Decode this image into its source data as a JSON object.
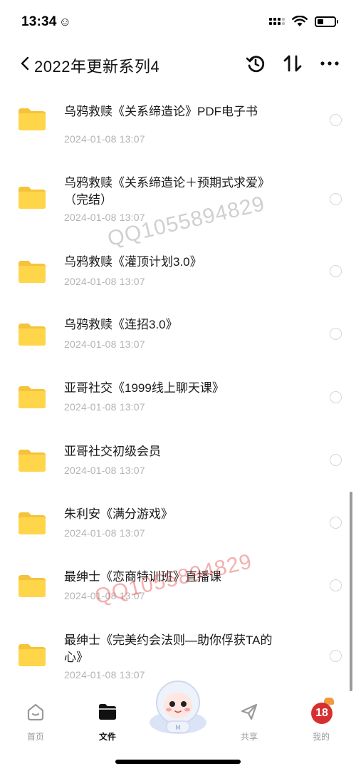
{
  "status": {
    "time": "13:34",
    "face_glyph": "☺"
  },
  "nav": {
    "title": "2022年更新系列4"
  },
  "files": [
    {
      "name": "乌鸦救赎《关系缔造论》PDF电子书",
      "date": "2024-01-08 13:07"
    },
    {
      "name": "乌鸦救赎《关系缔造论＋预期式求爱》（完结）",
      "date": "2024-01-08 13:07"
    },
    {
      "name": "乌鸦救赎《灌顶计划3.0》",
      "date": "2024-01-08 13:07"
    },
    {
      "name": "乌鸦救赎《连招3.0》",
      "date": "2024-01-08 13:07"
    },
    {
      "name": "亚哥社交《1999线上聊天课》",
      "date": "2024-01-08 13:07"
    },
    {
      "name": "亚哥社交初级会员",
      "date": "2024-01-08 13:07"
    },
    {
      "name": "朱利安《满分游戏》",
      "date": "2024-01-08 13:07"
    },
    {
      "name": "最绅士《恋商特训班》直播课",
      "date": "2024-01-08 13:07"
    },
    {
      "name": "最绅士《完美约会法则—助你俘获TA的心》",
      "date": "2024-01-08 13:07"
    }
  ],
  "watermarks": [
    "QQ1055894829",
    "QQ1055894829"
  ],
  "tabs": {
    "home": "首页",
    "files": "文件",
    "share": "共享",
    "mine": "我的"
  },
  "badge": "18",
  "colors": {
    "folder": "#FFD54A",
    "active": "#111111",
    "inactive": "#9A9A9A"
  }
}
